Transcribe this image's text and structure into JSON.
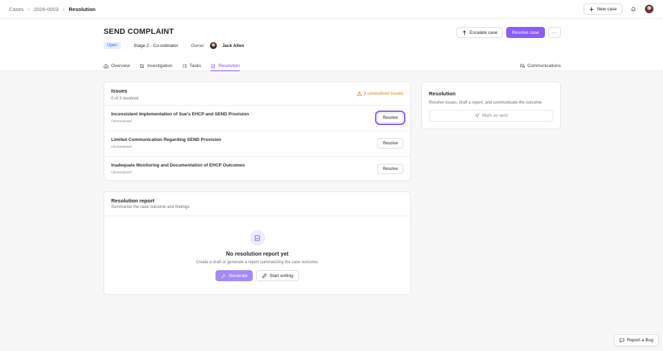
{
  "breadcrumb": {
    "items": [
      "Cases",
      "2026-0003",
      "Resolution"
    ]
  },
  "topbar": {
    "new_case_label": "New case"
  },
  "case": {
    "title": "SEND COMPLAINT",
    "status": "Open",
    "stage": "Stage 2 - Co-ordinator",
    "owner_label": "Owner",
    "owner_name": "Jack Allen"
  },
  "actions": {
    "escalate_label": "Escalate case",
    "resolve_label": "Resolve case",
    "more_label": "···"
  },
  "tabs": [
    {
      "label": "Overview",
      "icon": "home-icon"
    },
    {
      "label": "Investigation",
      "icon": "edit-square-icon"
    },
    {
      "label": "Tasks",
      "icon": "list-checks-icon"
    },
    {
      "label": "Resolution",
      "icon": "clipboard-icon",
      "active": true
    },
    {
      "label": "Communications",
      "icon": "chat-icon"
    }
  ],
  "issues_card": {
    "title": "Issues",
    "subtitle": "0 of 3 resolved",
    "warning": "3 unresolved issues",
    "items": [
      {
        "title": "Inconsistent Implementation of Sue's EHCP and SEND Provision",
        "status": "Unresolved",
        "action": "Resolve"
      },
      {
        "title": "Limited Communication Regarding SEND Provision",
        "status": "Unresolved",
        "action": "Resolve"
      },
      {
        "title": "Inadequate Monitoring and Documentation of EHCP Outcomes",
        "status": "Unresolved",
        "action": "Resolve"
      }
    ]
  },
  "report_card": {
    "title": "Resolution report",
    "subtitle": "Summarise the case outcome and findings",
    "empty_title": "No resolution report yet",
    "empty_sub": "Create a draft or generate a report summarizing the case outcome.",
    "generate_label": "Generate",
    "write_label": "Start writing"
  },
  "side_card": {
    "title": "Resolution",
    "subtitle": "Resolve issues, draft a report, and communicate the outcome",
    "mark_sent_label": "Mark as sent"
  },
  "report_bug_label": "Report a Bug",
  "colors": {
    "accent": "#8b5cf6",
    "warning": "#e0791f",
    "open_badge": "#2f6fe0"
  }
}
